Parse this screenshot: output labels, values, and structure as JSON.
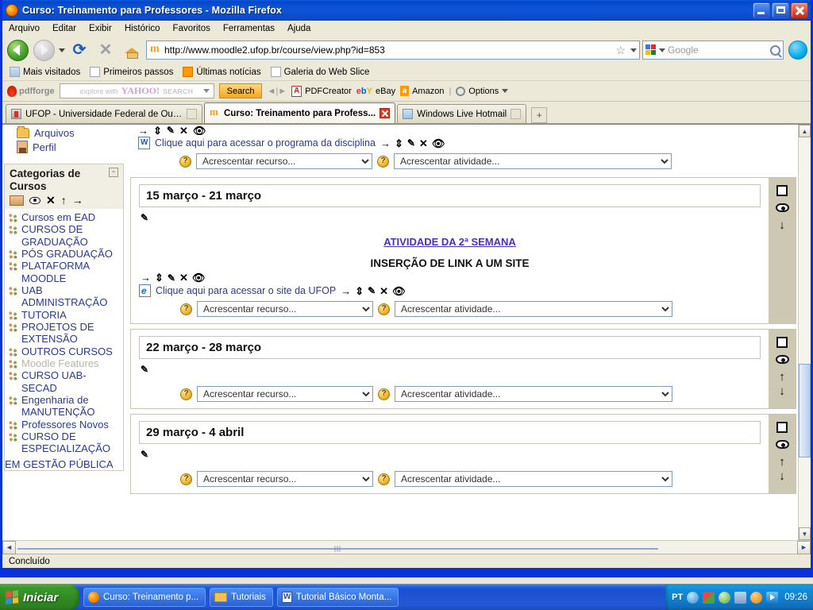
{
  "window": {
    "title": "Curso: Treinamento para Professores - Mozilla Firefox",
    "minimize_label": "Minimizar",
    "maximize_label": "Maximizar",
    "close_label": "Fechar"
  },
  "menubar": [
    {
      "label": "Arquivo"
    },
    {
      "label": "Editar"
    },
    {
      "label": "Exibir"
    },
    {
      "label": "Histórico"
    },
    {
      "label": "Favoritos"
    },
    {
      "label": "Ferramentas"
    },
    {
      "label": "Ajuda"
    }
  ],
  "navbar": {
    "back_label": "Voltar",
    "forward_label": "Avançar",
    "reload_label": "Recarregar",
    "stop_label": "Parar",
    "home_label": "Página inicial",
    "url": "http://www.moodle2.ufop.br/course/view.php?id=853",
    "bookmark_star_label": "Adicionar aos favoritos",
    "search_placeholder": "Google",
    "search_value": ""
  },
  "bookmarks": [
    {
      "label": "Mais visitados",
      "icon": "star-folder-icon"
    },
    {
      "label": "Primeiros passos",
      "icon": "page-icon"
    },
    {
      "label": "Últimas notícias",
      "icon": "rss-icon"
    },
    {
      "label": "Galeria do Web Slice",
      "icon": "page-icon"
    }
  ],
  "pdfbar": {
    "brand": "pdfforge",
    "yahoo_hint": "explore with",
    "yahoo_logo": "YAHOO!",
    "yahoo_search_word": "SEARCH",
    "search_button": "Search",
    "items": [
      {
        "label": "PDFCreator",
        "icon": "pdf-icon"
      },
      {
        "label": "eBay",
        "icon": "ebay-icon"
      },
      {
        "label": "Amazon",
        "icon": "amazon-icon"
      },
      {
        "label": "Options",
        "icon": "gear-icon"
      }
    ]
  },
  "tabs": [
    {
      "label": "UFOP - Universidade Federal de Ouro P...",
      "active": false,
      "icon": "ufop-icon"
    },
    {
      "label": "Curso: Treinamento para Profess...",
      "active": true,
      "icon": "moodle-icon"
    },
    {
      "label": "Windows Live Hotmail",
      "active": false,
      "icon": "hotmail-icon"
    }
  ],
  "newtab_label": "+",
  "sidebar": {
    "top_links": [
      {
        "label": "Arquivos",
        "icon": "folder-icon"
      },
      {
        "label": "Perfil",
        "icon": "person-icon"
      }
    ],
    "categories_block": {
      "title": "Categorias de Cursos",
      "collapse_label": "-",
      "tools": [
        "group-icon",
        "eye-icon",
        "delete-icon",
        "move-up-icon",
        "move-right-icon"
      ],
      "items": [
        {
          "label": "Cursos em EAD",
          "dim": false
        },
        {
          "label": "CURSOS DE GRADUAÇÃO",
          "dim": false
        },
        {
          "label": "PÓS GRADUAÇÃO",
          "dim": false
        },
        {
          "label": "PLATAFORMA MOODLE",
          "dim": false
        },
        {
          "label": "UAB ADMINISTRAÇÃO",
          "dim": false
        },
        {
          "label": "TUTORIA",
          "dim": false
        },
        {
          "label": "PROJETOS DE EXTENSÃO",
          "dim": false
        },
        {
          "label": "OUTROS CURSOS",
          "dim": false
        },
        {
          "label": "Moodle Features",
          "dim": true
        },
        {
          "label": "CURSO UAB-SECAD",
          "dim": false
        },
        {
          "label": "Engenharia de MANUTENÇÃO",
          "dim": false
        },
        {
          "label": "Professores Novos",
          "dim": false
        },
        {
          "label": "CURSO DE ESPECIALIZAÇÃO",
          "dim": false
        }
      ],
      "overflow_text": "EM GESTÃO PÚBLICA"
    }
  },
  "course": {
    "top_resource": {
      "label": "Clique aqui para acessar o programa da disciplina",
      "icon": "word-doc-icon",
      "actions": [
        "indent-right-icon",
        "move-icon",
        "edit-icon",
        "delete-icon",
        "hide-eye-icon"
      ]
    },
    "add_resource_label": "Acrescentar recurso...",
    "add_activity_label": "Acrescentar atividade...",
    "help_icon_label": "?",
    "sections": [
      {
        "title": "15 março - 21 março",
        "center_link": "ATIVIDADE DA 2ª SEMANA",
        "center_heading": "INSERÇÃO DE LINK A UM SITE",
        "resource": {
          "label": "Clique aqui para acessar o site da UFOP",
          "icon": "ie-link-icon"
        },
        "side_icons": [
          "highlight-square-icon",
          "eye-icon",
          "move-down-icon"
        ]
      },
      {
        "title": "22 março - 28 março",
        "center_link": "",
        "center_heading": "",
        "resource": null,
        "side_icons": [
          "highlight-square-icon",
          "eye-icon",
          "move-up-icon",
          "move-down-icon"
        ]
      },
      {
        "title": "29 março - 4 abril",
        "center_link": "",
        "center_heading": "",
        "resource": null,
        "side_icons": [
          "highlight-square-icon",
          "eye-icon",
          "move-up-icon",
          "move-down-icon"
        ]
      }
    ]
  },
  "statusbar": {
    "text": "Concluído"
  },
  "taskbar": {
    "start_label": "Iniciar",
    "buttons": [
      {
        "label": "Curso: Treinamento p...",
        "icon": "firefox-icon"
      },
      {
        "label": "Tutoriais",
        "icon": "folder-icon"
      },
      {
        "label": "Tutorial Básico Monta...",
        "icon": "word-icon"
      }
    ],
    "tray": {
      "language": "PT",
      "clock": "09:26",
      "icons": [
        "chevron-left-icon",
        "network-icon",
        "security-icon",
        "display-icon",
        "update-icon",
        "media-icon"
      ]
    }
  }
}
